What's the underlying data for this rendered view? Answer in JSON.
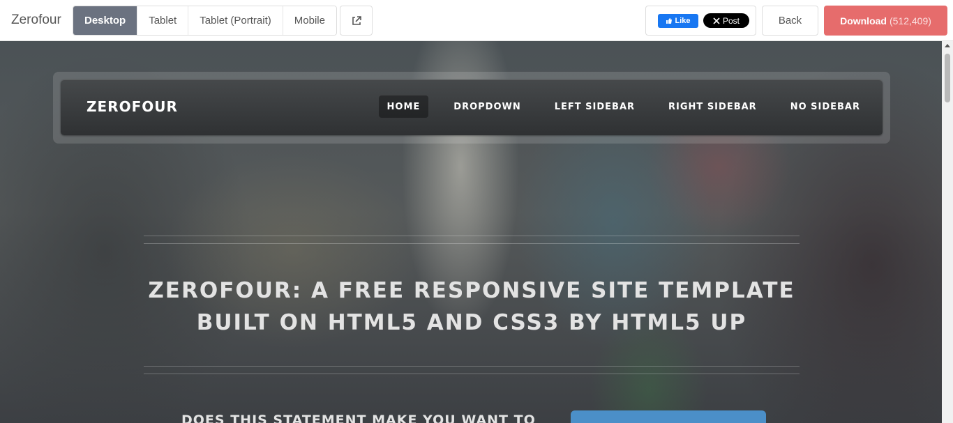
{
  "topbar": {
    "brand": "Zerofour",
    "devices": [
      "Desktop",
      "Tablet",
      "Tablet (Portrait)",
      "Mobile"
    ],
    "active_device": "Desktop",
    "external_icon": "external-link-icon",
    "facebook_like": "Like",
    "x_post": "Post",
    "back": "Back",
    "download_label": "Download",
    "download_count": "(512,409)"
  },
  "site": {
    "logo": "ZEROFOUR",
    "nav": [
      "HOME",
      "DROPDOWN",
      "LEFT SIDEBAR",
      "RIGHT SIDEBAR",
      "NO SIDEBAR"
    ],
    "active_nav": "HOME",
    "headline_line1": "ZEROFOUR: A FREE RESPONSIVE SITE TEMPLATE",
    "headline_line2": "BUILT ON HTML5 AND CSS3 BY HTML5 UP",
    "cta_text": "DOES THIS STATEMENT MAKE YOU WANT TO"
  },
  "colors": {
    "download_button": "#e66c6c",
    "active_device": "#6b7280",
    "facebook": "#1877f2",
    "cta_button": "#4b8fc8"
  }
}
